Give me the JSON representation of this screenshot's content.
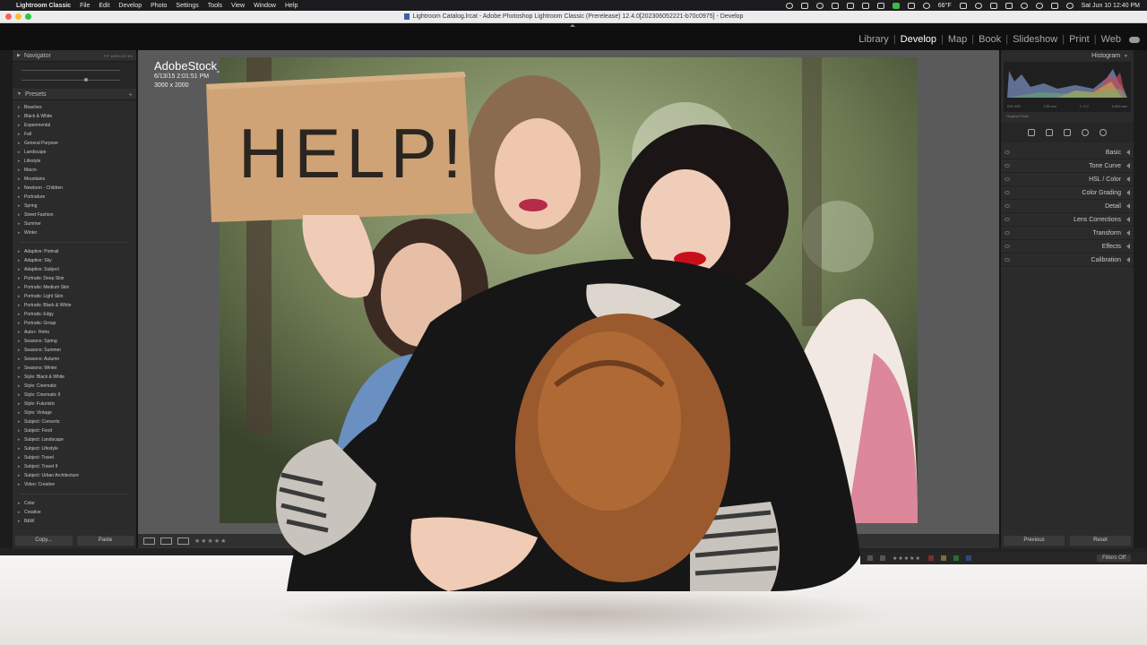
{
  "menubar": {
    "app": "Lightroom Classic",
    "items": [
      "File",
      "Edit",
      "Develop",
      "Photo",
      "Settings",
      "Tools",
      "View",
      "Window",
      "Help"
    ],
    "weather": "66°F",
    "datetime": "Sat Jun 10  12:40 PM"
  },
  "window": {
    "title": "Lightroom Catalog.lrcat - Adobe Photoshop Lightroom Classic (Prerelease) 12.4.0[202306052221-b70c0975] - Develop"
  },
  "modules": {
    "items": [
      "Library",
      "Develop",
      "Map",
      "Book",
      "Slideshow",
      "Print",
      "Web"
    ],
    "active": "Develop"
  },
  "left_panel": {
    "navigator_label": "Navigator",
    "navigator_zoom": "FIT   100%   237.4%",
    "presets_label": "Presets",
    "presets_group1": [
      "Beaches",
      "Black & White",
      "Experimental",
      "Fall",
      "General Purpose",
      "Landscape",
      "Lifestyle",
      "Macro",
      "Mountains",
      "Newborn - Children",
      "Portraiture",
      "Spring",
      "Street Fashion",
      "Summer",
      "Winter"
    ],
    "presets_group2": [
      "Adaptive: Portrait",
      "Adaptive: Sky",
      "Adaptive: Subject",
      "Portraits: Deep Skin",
      "Portraits: Medium Skin",
      "Portraits: Light Skin",
      "Portraits: Black & White",
      "Portraits: Edgy",
      "Portraits: Group",
      "Auto+: Retro",
      "Seasons: Spring",
      "Seasons: Summer",
      "Seasons: Autumn",
      "Seasons: Winter",
      "Style: Black & White",
      "Style: Cinematic",
      "Style: Cinematic II",
      "Style: Futuristic",
      "Style: Vintage",
      "Subject: Concerts",
      "Subject: Food",
      "Subject: Landscape",
      "Subject: Lifestyle",
      "Subject: Travel",
      "Subject: Travel II",
      "Subject: Urban Architecture",
      "Video: Creative"
    ],
    "presets_group3": [
      "Color",
      "Creative",
      "B&W"
    ],
    "copy_label": "Copy...",
    "paste_label": "Paste"
  },
  "photo_info": {
    "filename": "AdobeStock_90701121.jpeg",
    "datetime": "6/13/15 2:01:51 PM",
    "dimensions": "3000 x 2000"
  },
  "sign_text": "HELP!",
  "right_panel": {
    "histogram_label": "Histogram",
    "readout": [
      "ISO 400",
      "135 mm",
      "f / 3.2",
      "1/400 sec"
    ],
    "original_photo": "Original Photo",
    "sections": [
      "Basic",
      "Tone Curve",
      "HSL / Color",
      "Color Grading",
      "Detail",
      "Lens Corrections",
      "Transform",
      "Effects",
      "Calibration"
    ],
    "previous_label": "Previous",
    "reset_label": "Reset"
  },
  "filmstrip": {
    "filter_label": "Filters Off"
  }
}
